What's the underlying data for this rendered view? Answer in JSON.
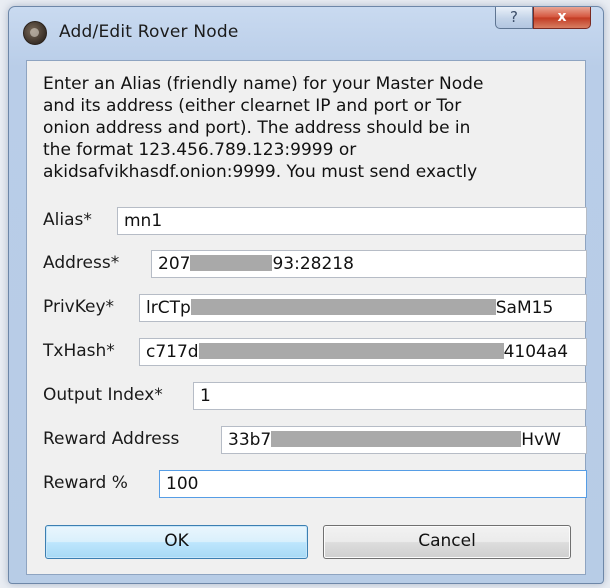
{
  "window": {
    "title": "Add/Edit Rover Node",
    "help_label": "?",
    "close_label": "x"
  },
  "description": "Enter an Alias (friendly name) for your Master Node\nand its address (either clearnet IP and port or Tor\nonion address and port). The address should be in\nthe format 123.456.789.123:9999 or\nakidsafvikhasdf.onion:9999. You must send exactly",
  "fields": {
    "alias": {
      "label": "Alias*",
      "value": "mn1"
    },
    "address": {
      "label": "Address*",
      "value_start": "207",
      "value_end": "93:28218"
    },
    "privkey": {
      "label": "PrivKey*",
      "value_start": "lrCTp",
      "value_end": "SaM15"
    },
    "txhash": {
      "label": "TxHash*",
      "value_start": "c717d",
      "value_end": "4104a4"
    },
    "output_index": {
      "label": "Output Index*",
      "value": "1"
    },
    "reward_address": {
      "label": "Reward Address",
      "value_start": "33b7",
      "value_end": "HvW"
    },
    "reward_percent": {
      "label": "Reward %",
      "value": "100"
    }
  },
  "buttons": {
    "ok": "OK",
    "cancel": "Cancel"
  },
  "colors": {
    "title_bg": "#c9daf0",
    "close_button": "#c23a22",
    "focus_border": "#569de5",
    "ok_button_border": "#3c7fb1"
  }
}
